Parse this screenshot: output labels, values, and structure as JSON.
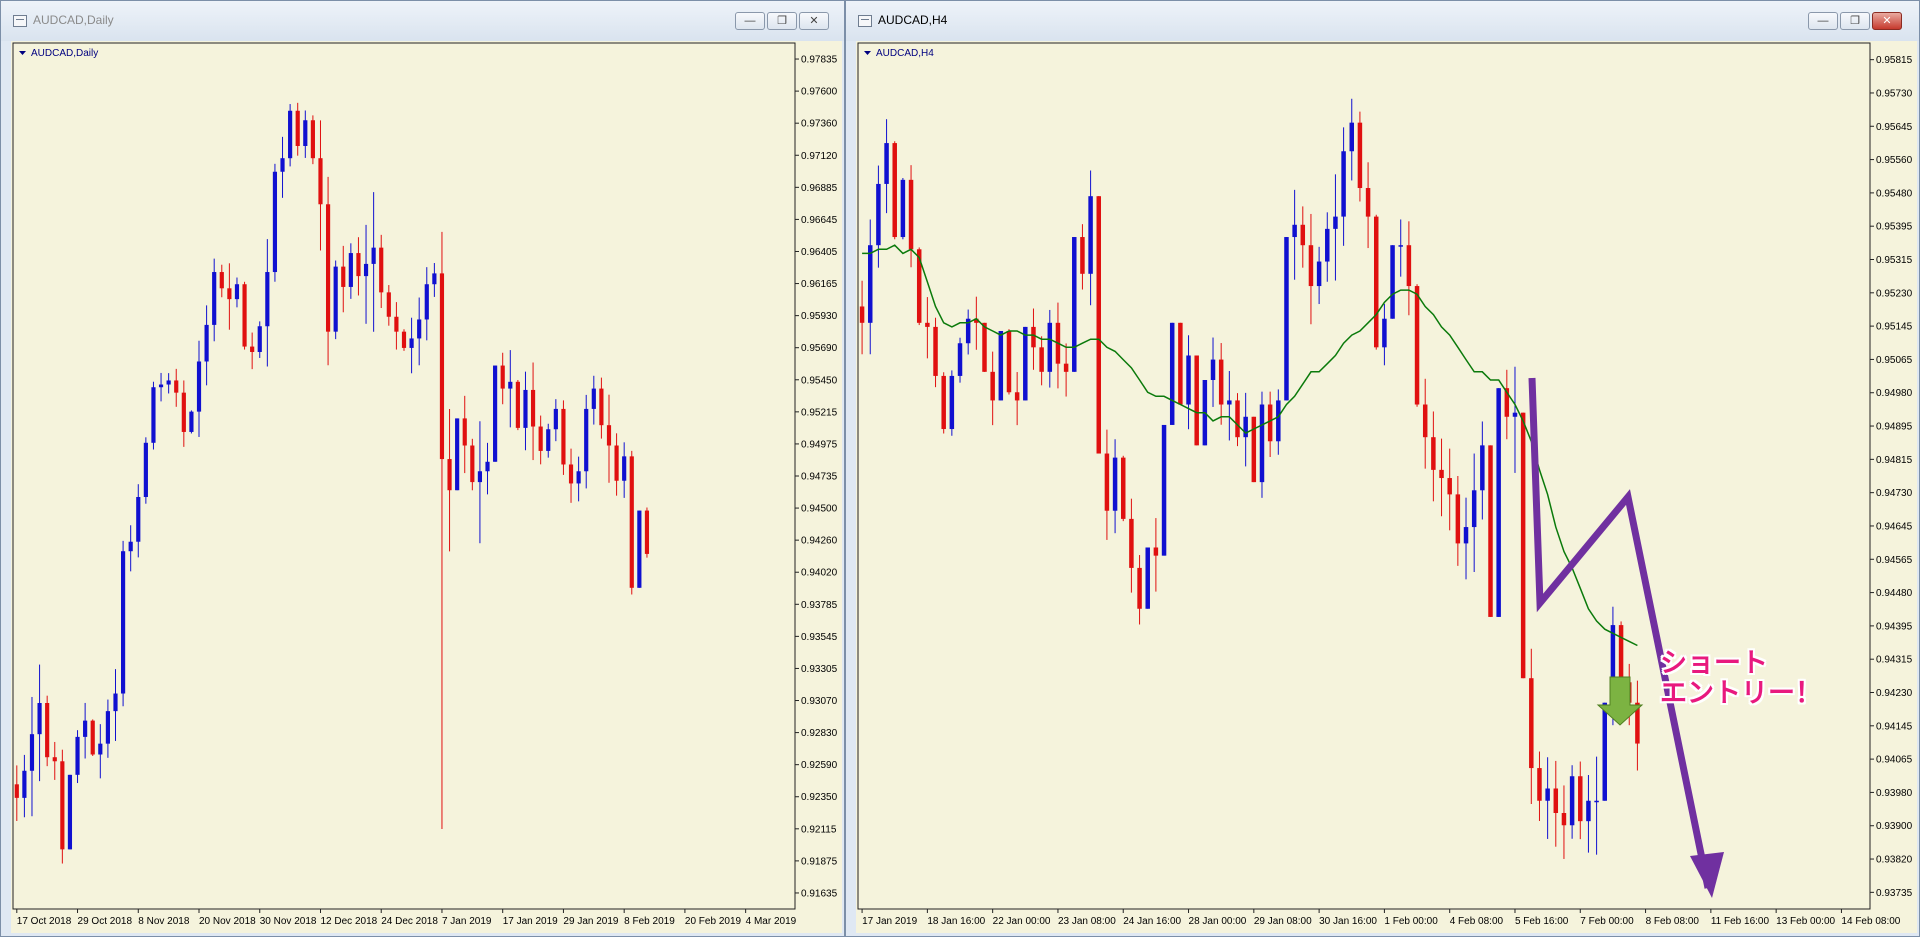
{
  "windows": [
    {
      "title": "AUDCAD,Daily",
      "active": false
    },
    {
      "title": "AUDCAD,H4",
      "active": true
    }
  ],
  "window_buttons": {
    "minimize": "—",
    "maximize": "❐",
    "close": "✕"
  },
  "annotation": {
    "entry_label": "ショート\nエントリー！"
  },
  "colors": {
    "bg": "#f5f3dc",
    "bull": "#1010d0",
    "bear": "#e01010",
    "grid": "#222222",
    "ma": "#0b7a0b",
    "arrow_purple": "#7030a0",
    "arrow_green": "#7cb342"
  },
  "chart_data": [
    {
      "type": "candlestick",
      "title": "AUDCAD,Daily",
      "ylim": [
        0.9156,
        0.9795
      ],
      "y_ticks": [
        "0.97835",
        "0.97600",
        "0.97360",
        "0.97120",
        "0.96885",
        "0.96645",
        "0.96405",
        "0.96165",
        "0.95930",
        "0.95690",
        "0.95450",
        "0.95215",
        "0.94975",
        "0.94735",
        "0.94500",
        "0.94260",
        "0.94020",
        "0.93785",
        "0.93545",
        "0.93305",
        "0.93070",
        "0.92830",
        "0.92590",
        "0.92350",
        "0.92115",
        "0.91875",
        "0.91635"
      ],
      "x_ticks": [
        "17 Oct 2018",
        "29 Oct 2018",
        "8 Nov 2018",
        "20 Nov 2018",
        "30 Nov 2018",
        "12 Dec 2018",
        "24 Dec 2018",
        "7 Jan 2019",
        "17 Jan 2019",
        "29 Jan 2019",
        "8 Feb 2019",
        "20 Feb 2019",
        "4 Mar 2019"
      ],
      "x_tick_index": [
        0,
        8,
        16,
        24,
        32,
        40,
        48,
        56,
        64,
        72,
        80,
        88,
        96
      ],
      "slots": 103,
      "closes": [
        0.9238,
        0.9258,
        0.9285,
        0.9308,
        0.9268,
        0.9265,
        0.92,
        0.9255,
        0.9283,
        0.9295,
        0.927,
        0.9278,
        0.9302,
        0.9315,
        0.942,
        0.9427,
        0.946,
        0.95,
        0.9541,
        0.9543,
        0.9546,
        0.9537,
        0.9508,
        0.9523,
        0.956,
        0.9587,
        0.9626,
        0.9614,
        0.9606,
        0.9617,
        0.9571,
        0.9567,
        0.9586,
        0.9626,
        0.97,
        0.971,
        0.9745,
        0.9719,
        0.9738,
        0.971,
        0.9676,
        0.9582,
        0.963,
        0.9615,
        0.964,
        0.9623,
        0.9632,
        0.9644,
        0.9611,
        0.9593,
        0.9582,
        0.957,
        0.9577,
        0.9591,
        0.9617,
        0.9625,
        0.9488,
        0.9465,
        0.9518,
        0.9498,
        0.9471,
        0.9479,
        0.9486,
        0.9557,
        0.954,
        0.9545,
        0.9511,
        0.9539,
        0.9512,
        0.9494,
        0.951,
        0.9525,
        0.9484,
        0.947,
        0.9479,
        0.9525,
        0.954,
        0.9513,
        0.9498,
        0.9472,
        0.949,
        0.9393,
        0.945,
        0.9418
      ],
      "ranges": [
        0.0041,
        0.0046,
        0.0088,
        0.0086,
        0.0052,
        0.0028,
        0.0084,
        0.0039,
        0.0039,
        0.0041,
        0.0027,
        0.004,
        0.0043,
        0.0053,
        0.0122,
        0.0034,
        0.0054,
        0.0049,
        0.005,
        0.0021,
        0.0015,
        0.0028,
        0.0049,
        0.0017,
        0.0071,
        0.0059,
        0.0061,
        0.0024,
        0.0049,
        0.0022,
        0.005,
        0.0027,
        0.0027,
        0.0094,
        0.0087,
        0.0045,
        0.0046,
        0.0039,
        0.0035,
        0.0036,
        0.0096,
        0.0139,
        0.0058,
        0.0049,
        0.0041,
        0.0043,
        0.0073,
        0.0103,
        0.0054,
        0.003,
        0.0035,
        0.0016,
        0.0041,
        0.005,
        0.0054,
        0.0025,
        0.0205,
        0.0105,
        0.0038,
        0.0057,
        0.0038,
        0.009,
        0.0038,
        0.0034,
        0.0038,
        0.0057,
        0.0037,
        0.0058,
        0.0072,
        0.0036,
        0.0025,
        0.0031,
        0.0055,
        0.004,
        0.0033,
        0.0069,
        0.0036,
        0.0045,
        0.0065,
        0.0046,
        0.0041,
        0.0106,
        0.0048,
        0.0037
      ],
      "lows": {
        "56": 0.9215
      }
    },
    {
      "type": "candlestick",
      "title": "AUDCAD,H4",
      "ylim": [
        0.93735,
        0.95855
      ],
      "y_ticks": [
        "0.95815",
        "0.95730",
        "0.95645",
        "0.95560",
        "0.95480",
        "0.95395",
        "0.95315",
        "0.95230",
        "0.95145",
        "0.95065",
        "0.94980",
        "0.94895",
        "0.94815",
        "0.94730",
        "0.94645",
        "0.94565",
        "0.94480",
        "0.94395",
        "0.94315",
        "0.94230",
        "0.94145",
        "0.94065",
        "0.93980",
        "0.93900",
        "0.93820",
        "0.93735"
      ],
      "x_ticks": [
        "17 Jan 2019",
        "18 Jan 16:00",
        "22 Jan 00:00",
        "23 Jan 08:00",
        "24 Jan 16:00",
        "28 Jan 00:00",
        "29 Jan 08:00",
        "30 Jan 16:00",
        "1 Feb 00:00",
        "4 Feb 08:00",
        "5 Feb 16:00",
        "7 Feb 00:00",
        "8 Feb 08:00",
        "11 Feb 16:00",
        "13 Feb 00:00",
        "14 Feb 08:00"
      ],
      "x_tick_index": [
        0,
        8,
        16,
        24,
        32,
        40,
        48,
        56,
        64,
        72,
        80,
        88,
        96,
        104,
        112,
        120
      ],
      "slots": 124,
      "closes": [
        0.9517,
        0.9536,
        0.9551,
        0.9561,
        0.9538,
        0.9552,
        0.9535,
        0.9517,
        0.9516,
        0.9504,
        0.9491,
        0.9504,
        0.9512,
        0.9518,
        0.9517,
        0.9505,
        0.9498,
        0.9515,
        0.95,
        0.9498,
        0.9516,
        0.9511,
        0.9505,
        0.9517,
        0.9507,
        0.9505,
        0.9538,
        0.9529,
        0.9548,
        0.9485,
        0.9471,
        0.9484,
        0.9469,
        0.9457,
        0.9447,
        0.9462,
        0.946,
        0.9492,
        0.9517,
        0.9497,
        0.9509,
        0.9487,
        0.9503,
        0.9508,
        0.9497,
        0.9498,
        0.9489,
        0.9494,
        0.9478,
        0.9497,
        0.9488,
        0.9498,
        0.9538,
        0.9541,
        0.9536,
        0.9526,
        0.9532,
        0.954,
        0.9543,
        0.9559,
        0.9566,
        0.955,
        0.9543,
        0.9511,
        0.9518,
        0.9536,
        0.9536,
        0.9526,
        0.9497,
        0.9489,
        0.9481,
        0.9479,
        0.9475,
        0.9463,
        0.9467,
        0.9476,
        0.9487,
        0.9445,
        0.9501,
        0.9494,
        0.9495,
        0.943,
        0.9408,
        0.94,
        0.9403,
        0.9397,
        0.9394,
        0.9406,
        0.9395,
        0.94,
        0.94,
        0.9424,
        0.9443,
        0.9429,
        0.9424,
        0.9414
      ],
      "ranges": [
        0.0018,
        0.0033,
        0.0025,
        0.0023,
        0.0024,
        0.0015,
        0.0025,
        0.0019,
        0.0015,
        0.0017,
        0.0015,
        0.0016,
        0.0011,
        0.0011,
        0.0013,
        0.0012,
        0.0018,
        0.0011,
        0.0016,
        0.0013,
        0.0015,
        0.0015,
        0.0012,
        0.0019,
        0.0021,
        0.0013,
        0.0025,
        0.0016,
        0.0033,
        0.0032,
        0.0027,
        0.0023,
        0.0016,
        0.0023,
        0.0017,
        0.0013,
        0.0018,
        0.0029,
        0.002,
        0.0017,
        0.0023,
        0.0016,
        0.0013,
        0.0017,
        0.002,
        0.0017,
        0.0013,
        0.0018,
        0.0016,
        0.0026,
        0.0016,
        0.0016,
        0.0031,
        0.0022,
        0.0015,
        0.0027,
        0.0014,
        0.0017,
        0.0026,
        0.0029,
        0.002,
        0.0022,
        0.0021,
        0.0033,
        0.0015,
        0.0018,
        0.0014,
        0.0023,
        0.003,
        0.0022,
        0.0022,
        0.0019,
        0.002,
        0.0022,
        0.002,
        0.0029,
        0.0024,
        0.0036,
        0.003,
        0.0017,
        0.0026,
        0.003,
        0.0038,
        0.0017,
        0.002,
        0.0021,
        0.0018,
        0.0018,
        0.0019,
        0.0019,
        0.0024,
        0.0024,
        0.0029,
        0.0016,
        0.0015,
        0.0022
      ],
      "ma": [
        0.9534,
        0.9534,
        0.9535,
        0.9535,
        0.9536,
        0.9534,
        0.9535,
        0.9533,
        0.9527,
        0.9521,
        0.9517,
        0.9516,
        0.9517,
        0.9517,
        0.9518,
        0.9516,
        0.9515,
        0.9514,
        0.9515,
        0.9515,
        0.9514,
        0.9514,
        0.9513,
        0.9513,
        0.9512,
        0.9511,
        0.9511,
        0.9512,
        0.9513,
        0.9513,
        0.9511,
        0.951,
        0.9508,
        0.9506,
        0.9503,
        0.95,
        0.9499,
        0.9499,
        0.9498,
        0.9497,
        0.9496,
        0.9495,
        0.9495,
        0.9493,
        0.9494,
        0.9494,
        0.9492,
        0.949,
        0.9491,
        0.9492,
        0.9493,
        0.9494,
        0.9497,
        0.9499,
        0.9502,
        0.9505,
        0.9505,
        0.9507,
        0.9509,
        0.9512,
        0.9514,
        0.9515,
        0.9517,
        0.9519,
        0.9522,
        0.9524,
        0.9525,
        0.9525,
        0.9524,
        0.9521,
        0.9519,
        0.9516,
        0.9514,
        0.9511,
        0.9508,
        0.9505,
        0.9505,
        0.9503,
        0.9503,
        0.95,
        0.9497,
        0.9493,
        0.9488,
        0.9481,
        0.9475,
        0.9467,
        0.9461,
        0.9457,
        0.9452,
        0.9447,
        0.9444,
        0.9442,
        0.9441,
        0.944,
        0.9439,
        0.9438
      ]
    }
  ]
}
